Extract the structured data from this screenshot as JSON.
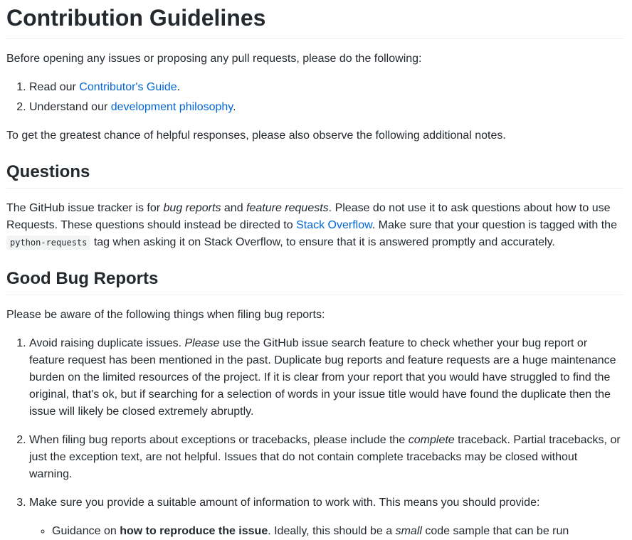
{
  "title": "Contribution Guidelines",
  "intro": "Before opening any issues or proposing any pull requests, please do the following:",
  "steps": [
    {
      "prefix": "Read our ",
      "link": "Contributor's Guide",
      "suffix": "."
    },
    {
      "prefix": "Understand our ",
      "link": "development philosophy",
      "suffix": "."
    }
  ],
  "notes_intro": "To get the greatest chance of helpful responses, please also observe the following additional notes.",
  "questions": {
    "heading": "Questions",
    "t1": "The GitHub issue tracker is for ",
    "em1": "bug reports",
    "t2": " and ",
    "em2": "feature requests",
    "t3": ". Please do not use it to ask questions about how to use Requests. These questions should instead be directed to ",
    "link": "Stack Overflow",
    "t4": ". Make sure that your question is tagged with the ",
    "code": "python-requests",
    "t5": " tag when asking it on Stack Overflow, to ensure that it is answered promptly and accurately."
  },
  "bugs": {
    "heading": "Good Bug Reports",
    "intro": "Please be aware of the following things when filing bug reports:",
    "item1": {
      "t1": "Avoid raising duplicate issues. ",
      "em": "Please",
      "t2": " use the GitHub issue search feature to check whether your bug report or feature request has been mentioned in the past. Duplicate bug reports and feature requests are a huge maintenance burden on the limited resources of the project. If it is clear from your report that you would have struggled to find the original, that's ok, but if searching for a selection of words in your issue title would have found the duplicate then the issue will likely be closed extremely abruptly."
    },
    "item2": {
      "t1": "When filing bug reports about exceptions or tracebacks, please include the ",
      "em": "complete",
      "t2": " traceback. Partial tracebacks, or just the exception text, are not helpful. Issues that do not contain complete tracebacks may be closed without warning."
    },
    "item3": {
      "text": "Make sure you provide a suitable amount of information to work with. This means you should provide:"
    },
    "sub1": {
      "t1": "Guidance on ",
      "strong": "how to reproduce the issue",
      "t2": ". Ideally, this should be a ",
      "em": "small",
      "t3": " code sample that can be run"
    }
  }
}
